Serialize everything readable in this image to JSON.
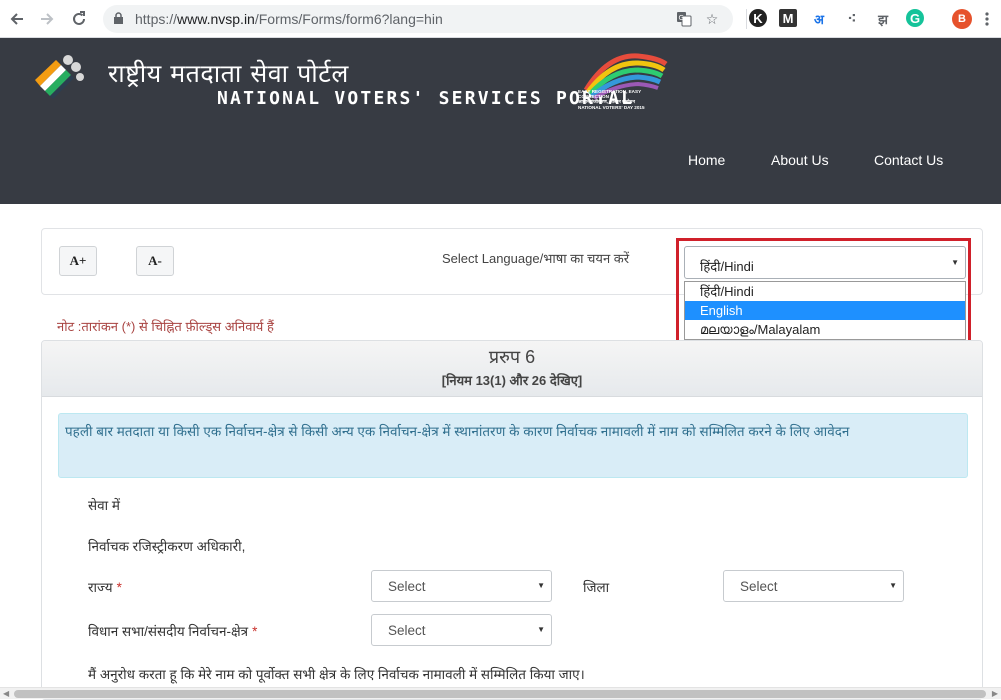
{
  "browser": {
    "url_scheme": "https://",
    "url_host": "www.nvsp.in",
    "url_path": "/Forms/Forms/form6?lang=hin",
    "extensions": [
      "K",
      "M",
      "अ",
      "⁖",
      "झ",
      "G"
    ],
    "profile_initial": "B",
    "profile_color": "#e6522c"
  },
  "header": {
    "title_hindi": "राष्ट्रीय मतदाता सेवा पोर्टल",
    "title_english": "NATIONAL VOTERS' SERVICES PORTAL",
    "nvd_text": [
      "EASY REGISTRATION, EASY CORRECTION",
      "आसान पंजीकरण, आसान संशोधन",
      "NATIONAL VOTERS' DAY 2015"
    ],
    "nav": [
      "Home",
      "About Us",
      "Contact Us"
    ],
    "bg_color": "#373b43"
  },
  "toolbar": {
    "font_increase": "A+",
    "font_decrease": "A-",
    "language_label": "Select Language/भाषा का चयन करें",
    "language_selected": "हिंदी/Hindi",
    "language_options": [
      "हिंदी/Hindi",
      "English",
      "മലയാളം/Malayalam"
    ],
    "language_highlighted": "English"
  },
  "note": "नोट :तारांकन (*) से चिह्नित फ़ील्ड्स अनिवार्य हैं",
  "form": {
    "title": "प्ररुप 6",
    "subtitle": "[नियम 13(1) और 26 देखिए]",
    "info": "पहली बार मतदाता या किसी एक निर्वाचन-क्षेत्र से किसी अन्य एक निर्वाचन-क्षेत्र में स्थानांतरण के कारण निर्वाचक नामावली में नाम को सम्मिलित करने के लिए आवेदन",
    "salutation": "सेवा में",
    "addressee": "निर्वाचक रजिस्ट्रीकरण अधिकारी,",
    "state_label": "राज्य",
    "state_value": "Select",
    "district_label": "जिला",
    "district_value": "Select",
    "constituency_label": "विधान सभा/संसदीय निर्वाचन-क्षेत्र",
    "constituency_value": "Select",
    "request_text": "मैं अनुरोध करता हू कि मेरे नाम को पूर्वोक्त सभी क्षेत्र के लिए निर्वाचक नामावली में सम्मिलित किया जाए।",
    "required_mark": "*"
  },
  "colors": {
    "highlight_border": "#d0202a",
    "option_highlight": "#1e90ff",
    "info_bg": "#d9edf7",
    "note_text": "#a94442"
  }
}
